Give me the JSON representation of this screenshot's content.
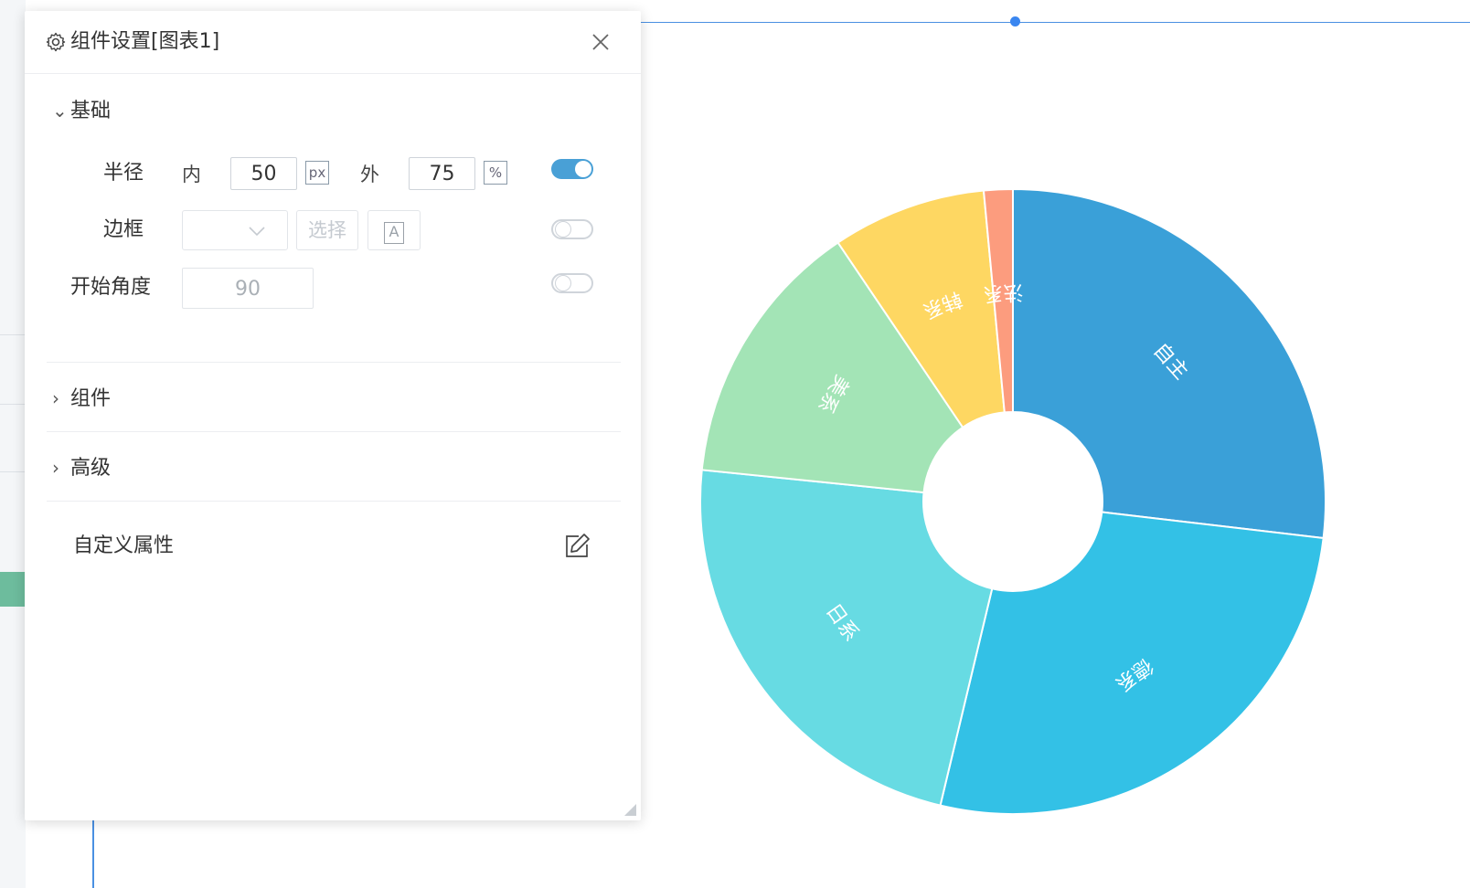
{
  "panel": {
    "title": "组件设置[图表1]",
    "sections": {
      "basic": "基础",
      "component": "组件",
      "advanced": "高级"
    },
    "radius": {
      "label": "半径",
      "inner_label": "内",
      "inner_value": "50",
      "inner_unit": "px",
      "outer_label": "外",
      "outer_value": "75",
      "outer_unit": "%",
      "toggle_on": true
    },
    "border": {
      "label": "边框",
      "select_button": "选择",
      "font_button": "A",
      "toggle_on": false
    },
    "start_angle": {
      "label": "开始角度",
      "value": "90",
      "toggle_on": false
    },
    "custom_attr_label": "自定义属性"
  },
  "colors": {
    "accent": "#49a0d6",
    "selection": "#4a90e2"
  },
  "chart_data": {
    "type": "pie",
    "donut": true,
    "categories": [
      "自主",
      "德系",
      "日系",
      "美系",
      "韩系",
      "法系"
    ],
    "values": [
      27,
      27,
      23,
      14,
      8,
      1.5
    ],
    "colors": [
      "#3aa0d8",
      "#33c1e6",
      "#67dbe3",
      "#a3e4b6",
      "#fed762",
      "#fc9c7e"
    ]
  }
}
